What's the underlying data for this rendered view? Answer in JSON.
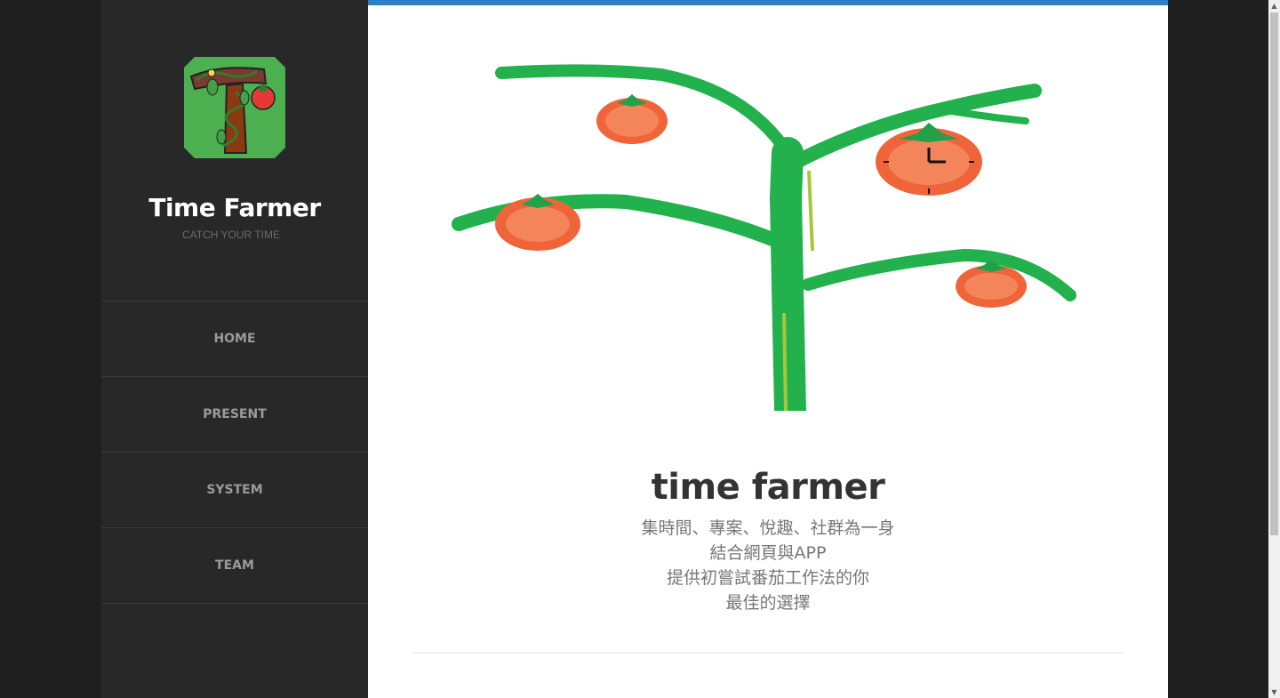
{
  "site": {
    "title": "Time Farmer",
    "tagline": "CATCH YOUR TIME",
    "logo_icon": "tomato-vine-logo-icon"
  },
  "nav": {
    "items": [
      {
        "label": "HOME"
      },
      {
        "label": "PRESENT"
      },
      {
        "label": "SYSTEM"
      },
      {
        "label": "TEAM"
      }
    ]
  },
  "main": {
    "hero_icon": "tomato-tree-illustration",
    "headline": "time farmer",
    "description_lines": [
      "集時間、專案、悅趣、社群為一身",
      "結合網頁與APP",
      "提供初嘗試番茄工作法的你",
      "最佳的選擇"
    ]
  },
  "colors": {
    "accent_bar": "#2f80c2",
    "sidebar_bg": "#282828",
    "page_bg": "#1f1f1f",
    "tree_green": "#22b14c",
    "tomato": "#f0643a"
  },
  "scrollbar": {
    "up_arrow": "▲",
    "down_arrow": "▼"
  }
}
